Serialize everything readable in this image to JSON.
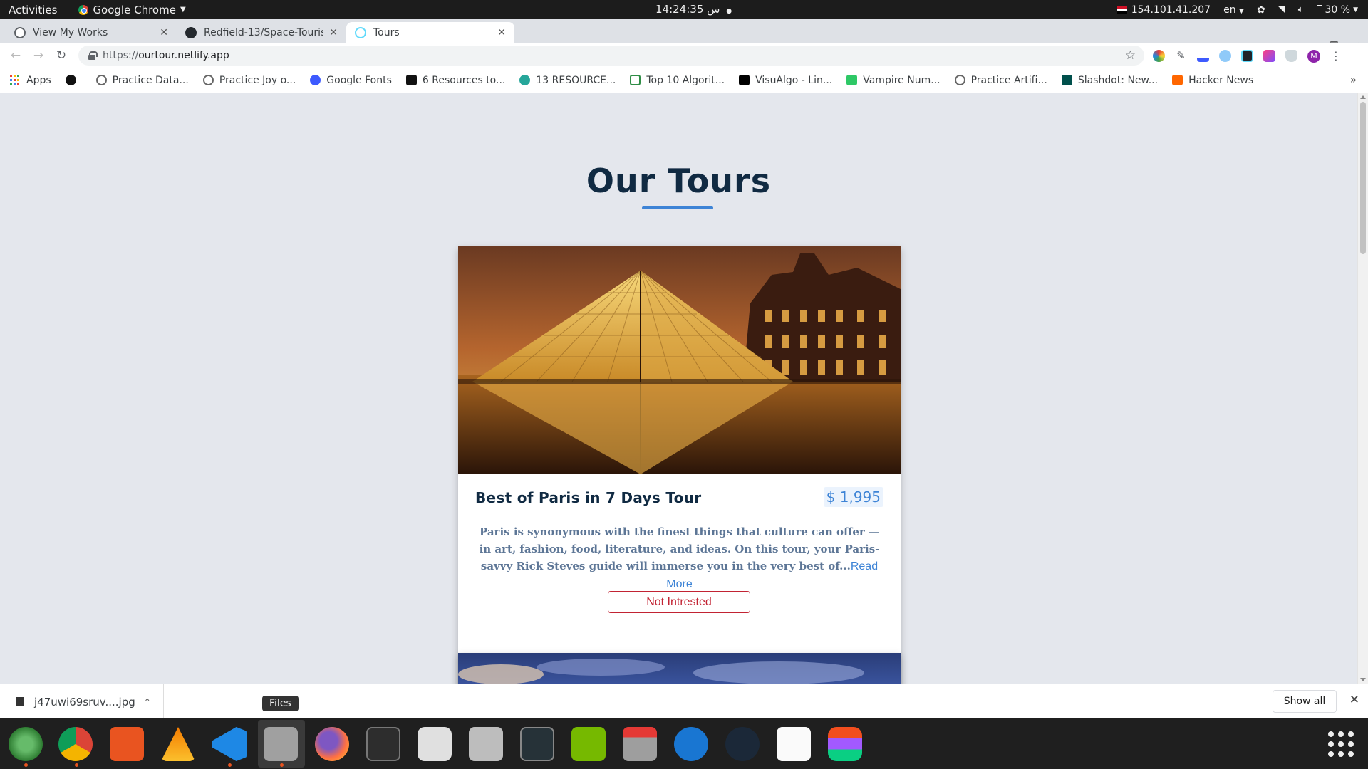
{
  "topbar": {
    "activities": "Activities",
    "app_name": "Google Chrome",
    "clock": "14:24:35 س",
    "ip": "154.101.41.207",
    "lang": "en",
    "battery": "30 %"
  },
  "tabs": [
    {
      "label": "View My Works",
      "favicon_color": "#5f6368",
      "icon": "globe-icon"
    },
    {
      "label": "Redfield-13/Space-Touris",
      "favicon_color": "#24292e",
      "icon": "github-icon"
    },
    {
      "label": "Tours",
      "favicon_color": "#61dafb",
      "icon": "react-icon",
      "active": true
    }
  ],
  "toolbar": {
    "url_protocol": "https://",
    "url_host": "ourtour.netlify.app",
    "profile_initial": "M"
  },
  "bookmarks": [
    {
      "label": "Apps",
      "icon": "apps-grid-icon"
    },
    {
      "label": "",
      "icon": "github-icon"
    },
    {
      "label": "Practice Data...",
      "icon": "globe-icon"
    },
    {
      "label": "Practice Joy o...",
      "icon": "globe-icon"
    },
    {
      "label": "Google Fonts",
      "icon": "google-fonts-icon"
    },
    {
      "label": "6 Resources to...",
      "icon": "medium-icon"
    },
    {
      "label": "13 RESOURCE...",
      "icon": "site-icon"
    },
    {
      "label": "Top 10 Algorit...",
      "icon": "gfg-icon"
    },
    {
      "label": "VisuAlgo - Lin...",
      "icon": "visualgo-icon"
    },
    {
      "label": "Vampire Num...",
      "icon": "hackerrank-icon"
    },
    {
      "label": "Practice Artifi...",
      "icon": "globe-icon"
    },
    {
      "label": "Slashdot: New...",
      "icon": "slashdot-icon"
    },
    {
      "label": "Hacker News",
      "icon": "hackernews-icon"
    }
  ],
  "page": {
    "title": "Our Tours",
    "tour": {
      "name": "Best of Paris in 7 Days Tour",
      "price": "$ 1,995",
      "description": "Paris is synonymous with the finest things that culture can offer — in art, fashion, food, literature, and ideas. On this tour, your Paris-savvy Rick Steves guide will immerse you in the very best of...",
      "read_more": "Read More",
      "not_interested": "Not Intrested"
    }
  },
  "downloads": {
    "file_name": "j47uwi69sruv....jpg",
    "show_all": "Show all"
  },
  "dock": {
    "tooltip": "Files",
    "apps": [
      "atom",
      "chrome",
      "software-center",
      "vlc",
      "vscode",
      "files",
      "firefox",
      "terminal",
      "rhythmbox",
      "settings",
      "system-monitor",
      "nvidia-settings",
      "installer",
      "help",
      "steam",
      "evince",
      "figma"
    ]
  },
  "colors": {
    "heading": "#102a42",
    "accent": "#3e84d6",
    "danger": "#c22333",
    "page_bg": "#e4e7ed"
  }
}
